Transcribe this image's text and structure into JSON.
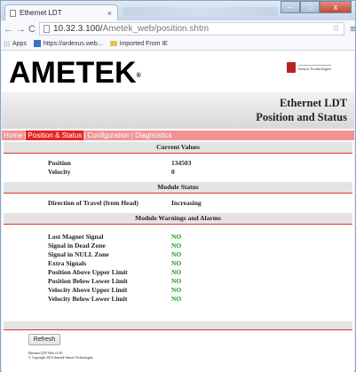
{
  "browser": {
    "tab_title": "Ethernet LDT",
    "tab_close": "×",
    "url_prefix": "10.32.3.100/",
    "url_path": "Ametek_web/position.shtm",
    "back": "←",
    "forward": "→",
    "reload": "C",
    "star": "☆",
    "menu": "≡",
    "bookmarks": [
      {
        "label": "Apps"
      },
      {
        "label": "https://ardexus.web..."
      },
      {
        "label": "Imported From IE"
      }
    ],
    "window_controls": {
      "minimize": "–",
      "maximize": "□",
      "close": "x"
    }
  },
  "header": {
    "brand": "AMETEK",
    "brand_mark": "®",
    "partner_logo": "Sensor Technologies",
    "title_line1": "Ethernet LDT",
    "title_line2": "Position and Status"
  },
  "menu": {
    "items": [
      {
        "label": "Home"
      },
      {
        "label": "Position & Status"
      },
      {
        "label": "Configuration"
      },
      {
        "label": "Diagnostics"
      }
    ],
    "separator": "|"
  },
  "sections": {
    "current_values": {
      "title": "Current Values",
      "rows": [
        {
          "label": "Position",
          "value": "134503"
        },
        {
          "label": "Velocity",
          "value": "0"
        }
      ]
    },
    "module_status": {
      "title": "Module Status",
      "rows": [
        {
          "label": "Direction of Travel (from Head)",
          "value": "Increasing"
        }
      ]
    },
    "warnings": {
      "title": "Module Warnings and Alarms",
      "rows": [
        {
          "label": "Lost Magnet Signal",
          "value": "NO"
        },
        {
          "label": "Signal in Dead Zone",
          "value": "NO"
        },
        {
          "label": "Signal in NULL Zone",
          "value": "NO"
        },
        {
          "label": "Extra Signals",
          "value": "NO"
        },
        {
          "label": "Position Above Upper Limit",
          "value": "NO"
        },
        {
          "label": "Position Below Lower Limit",
          "value": "NO"
        },
        {
          "label": "Velocity Above Upper Limit",
          "value": "NO"
        },
        {
          "label": "Velocity Below Lower Limit",
          "value": "NO"
        }
      ]
    }
  },
  "footer": {
    "refresh_label": "Refresh",
    "version": "Ethernet LDT Web v1.00",
    "copyright": "© Copyright 2014 Ametek Sensor Technologies"
  },
  "colors": {
    "accent_red": "#e52424",
    "menu_pink": "#f19393",
    "ok_green": "#1a9a1a"
  }
}
